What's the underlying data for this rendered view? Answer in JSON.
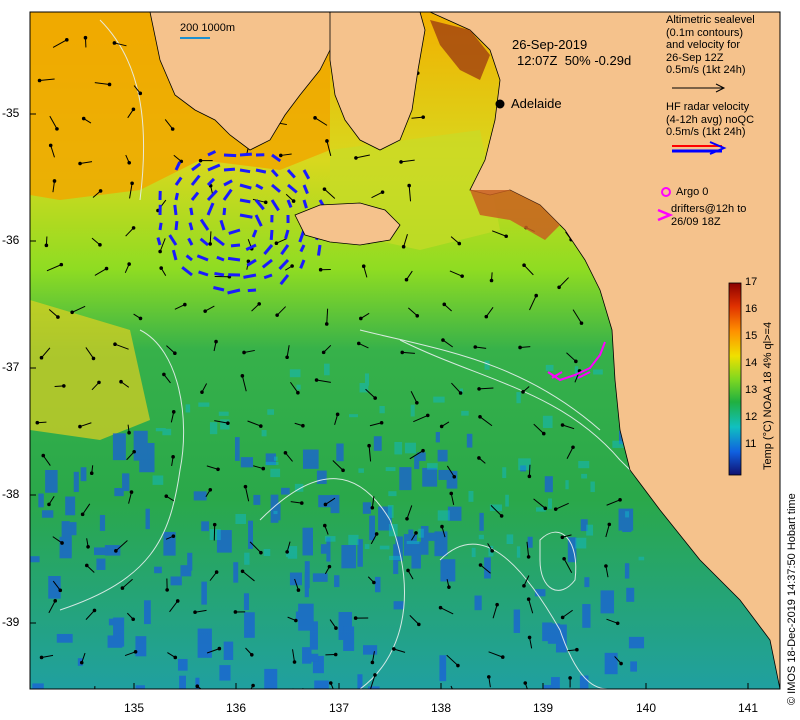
{
  "date_line": "26-Sep-2019",
  "time_line": "12:07Z  50% -0.29d",
  "scale_label": "200  1000m",
  "city_label": "Adelaide",
  "legend": {
    "altimetry_lines": [
      "Altimetric sealevel",
      "(0.1m contours)",
      "and velocity for",
      "26-Sep 12Z",
      "0.5m/s (1kt 24h)"
    ],
    "radar_lines": [
      "HF radar velocity",
      "(4-12h avg) noQC",
      "0.5m/s (1kt 24h)"
    ],
    "argo_label": "Argo 0",
    "drifter_lines": [
      "drifters@12h to",
      "26/09 18Z"
    ],
    "argo_color": "#ff00ff",
    "drifter_color": "#ff00ff",
    "radar_colors": [
      "#ff0000",
      "#0000ff"
    ]
  },
  "colorbar": {
    "ticks": [
      "17",
      "16",
      "15",
      "14",
      "13",
      "12",
      "11"
    ],
    "title": "Temp (°C) NOAA 18 4% ql>=4"
  },
  "credit": "© IMOS 18-Dec-2019 14:37:50 Hobart time",
  "axes": {
    "y_ticks": [
      "-35",
      "-36",
      "-37",
      "-38",
      "-39"
    ],
    "x_ticks": [
      "135",
      "136",
      "137",
      "138",
      "139",
      "140",
      "141"
    ]
  },
  "colors": {
    "land": "#f5c28c",
    "ocean_warm": "#e8a800",
    "ocean_mid": "#7fd21e",
    "ocean_cool": "#2aa848",
    "ocean_cold": "#1a5fd8"
  }
}
